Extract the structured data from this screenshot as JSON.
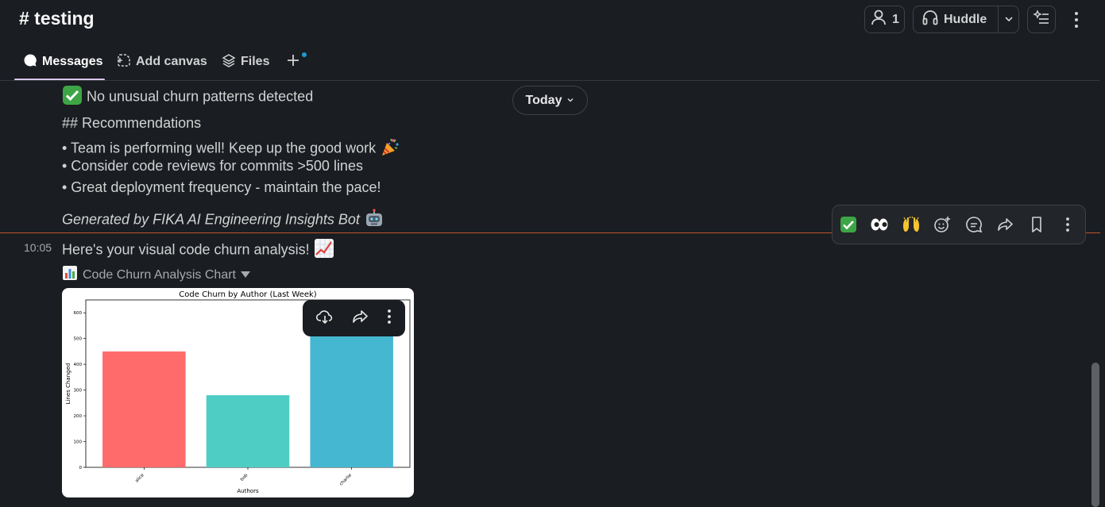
{
  "header": {
    "channel": "# testing",
    "members_count": "1",
    "huddle_label": "Huddle"
  },
  "tabs": [
    {
      "label": "Messages"
    },
    {
      "label": "Add canvas"
    },
    {
      "label": "Files"
    }
  ],
  "date_divider": "Today",
  "previous_message": {
    "status_line": "No unusual churn patterns detected",
    "heading": "## Recommendations",
    "bullets": [
      "• Team is performing well! Keep up the good work",
      "• Consider code reviews for commits >500 lines",
      "• Great deployment frequency - maintain the pace!"
    ],
    "footer": "Generated by FIKA AI Engineering Insights Bot"
  },
  "message": {
    "time": "10:05",
    "text": "Here's your visual code churn analysis!",
    "file_name": "Code Churn Analysis Chart"
  },
  "colors": {
    "accent_bar_alice": "#ff6b6b",
    "accent_bar_bob": "#4ecdc4",
    "accent_bar_charlie": "#45b7d1",
    "new_message_line": "#c1542f"
  },
  "action_bar_icons": [
    "check-emoji-icon",
    "eyes-emoji-icon",
    "raised-hands-emoji-icon",
    "add-reaction-icon",
    "reply-thread-icon",
    "forward-icon",
    "bookmark-icon",
    "more-icon"
  ],
  "chart_data": {
    "type": "bar",
    "title": "Code Churn by Author (Last Week)",
    "xlabel": "Authors",
    "ylabel": "Lines Changed",
    "categories": [
      "alice",
      "bob",
      "charlie"
    ],
    "values": [
      450,
      280,
      560
    ],
    "colors": [
      "#ff6b6b",
      "#4ecdc4",
      "#45b7d1"
    ],
    "ylim": [
      0,
      650
    ],
    "yticks": [
      0,
      100,
      200,
      300,
      400,
      500,
      600
    ]
  }
}
